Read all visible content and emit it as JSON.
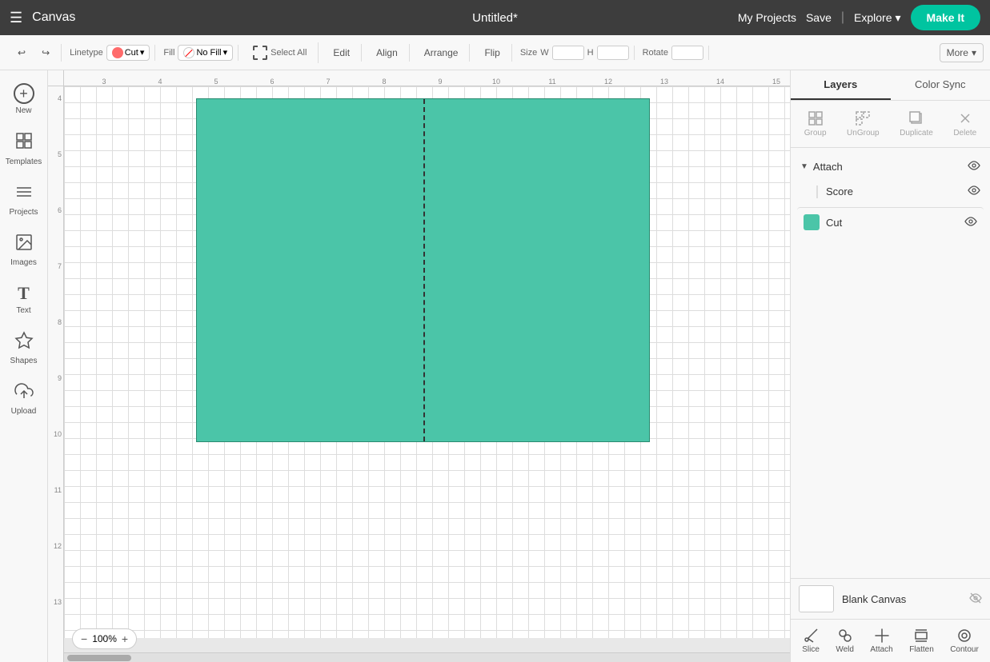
{
  "navbar": {
    "hamburger_icon": "☰",
    "app_title": "Canvas",
    "doc_title": "Untitled*",
    "my_projects_label": "My Projects",
    "save_label": "Save",
    "divider": "|",
    "explore_label": "Explore",
    "explore_chevron": "▾",
    "make_it_label": "Make It"
  },
  "toolbar": {
    "undo_icon": "↩",
    "redo_icon": "↪",
    "linetype_label": "Linetype",
    "linetype_value": "Cut",
    "fill_label": "Fill",
    "fill_value": "No Fill",
    "select_all_label": "Select All",
    "edit_label": "Edit",
    "align_label": "Align",
    "arrange_label": "Arrange",
    "flip_label": "Flip",
    "size_label": "Size",
    "w_label": "W",
    "h_label": "H",
    "rotate_label": "Rotate",
    "more_label": "More",
    "more_chevron": "▾"
  },
  "sidebar": {
    "items": [
      {
        "id": "new",
        "icon": "＋",
        "label": "New"
      },
      {
        "id": "templates",
        "icon": "🗋",
        "label": "Templates"
      },
      {
        "id": "projects",
        "icon": "⊞",
        "label": "Projects"
      },
      {
        "id": "images",
        "icon": "🖼",
        "label": "Images"
      },
      {
        "id": "text",
        "icon": "T",
        "label": "Text"
      },
      {
        "id": "shapes",
        "icon": "⬡",
        "label": "Shapes"
      },
      {
        "id": "upload",
        "icon": "⬆",
        "label": "Upload"
      }
    ]
  },
  "canvas": {
    "ruler_numbers_h": [
      "3",
      "4",
      "5",
      "6",
      "7",
      "8",
      "9",
      "10",
      "11",
      "12",
      "13",
      "14",
      "15"
    ],
    "ruler_numbers_v": [
      "4",
      "5",
      "6",
      "7",
      "8",
      "9",
      "10",
      "11",
      "12",
      "13"
    ],
    "zoom_minus": "−",
    "zoom_percent": "100%",
    "zoom_plus": "+"
  },
  "right_panel": {
    "tabs": [
      {
        "id": "layers",
        "label": "Layers"
      },
      {
        "id": "color_sync",
        "label": "Color Sync"
      }
    ],
    "tools": [
      {
        "id": "group",
        "label": "Group",
        "icon": "⊞"
      },
      {
        "id": "ungroup",
        "label": "UnGroup",
        "icon": "⊟"
      },
      {
        "id": "duplicate",
        "label": "Duplicate",
        "icon": "⧉"
      },
      {
        "id": "delete",
        "label": "Delete",
        "icon": "🗑"
      }
    ],
    "attach_label": "Attach",
    "attach_eye_icon": "👁",
    "score_label": "Score",
    "score_eye_icon": "👁",
    "cut_label": "Cut",
    "cut_eye_icon": "👁",
    "cut_color": "#4bc5a8",
    "blank_canvas_label": "Blank Canvas",
    "blank_canvas_eye_icon": "👁",
    "bottom_tools": [
      {
        "id": "slice",
        "label": "Slice",
        "icon": "✂"
      },
      {
        "id": "weld",
        "label": "Weld",
        "icon": "⌥"
      },
      {
        "id": "attach",
        "label": "Attach",
        "icon": "📎"
      },
      {
        "id": "flatten",
        "label": "Flatten",
        "icon": "⬜"
      },
      {
        "id": "contour",
        "label": "Contour",
        "icon": "◯"
      }
    ]
  }
}
